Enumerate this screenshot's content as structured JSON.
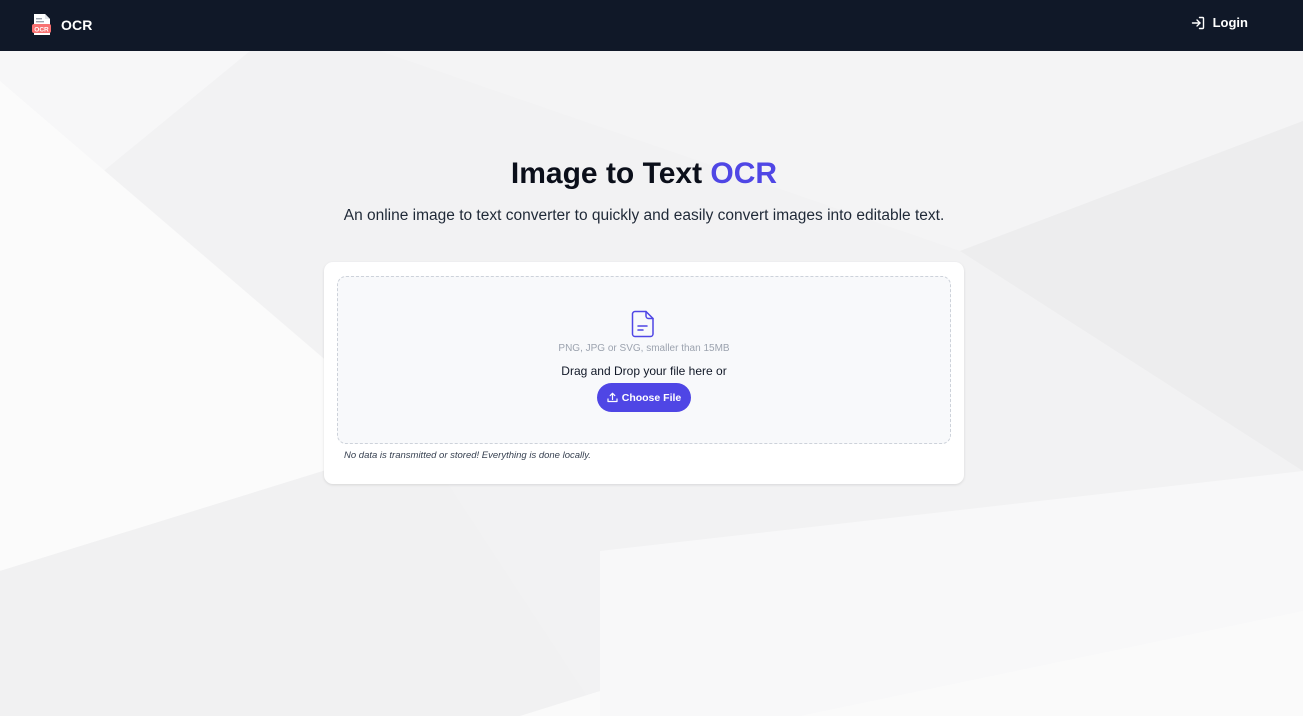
{
  "navbar": {
    "brand": "OCR",
    "logo_badge": "OCR",
    "login_label": "Login"
  },
  "hero": {
    "title_main": "Image to Text",
    "title_accent": "OCR",
    "subtitle": "An online image to text converter to quickly and easily convert images into editable text."
  },
  "upload": {
    "hint": "PNG, JPG or SVG, smaller than 15MB",
    "drag_text": "Drag and Drop your file here or",
    "button_label": "Choose File",
    "note": "No data is transmitted or stored! Everything is done locally."
  },
  "colors": {
    "accent": "#4f46e5",
    "navbar": "#101828",
    "logo_badge": "#f87171"
  },
  "icons": {
    "logo": "document-ocr-icon",
    "login": "login-arrow-icon",
    "file": "file-text-icon",
    "upload": "upload-icon"
  }
}
